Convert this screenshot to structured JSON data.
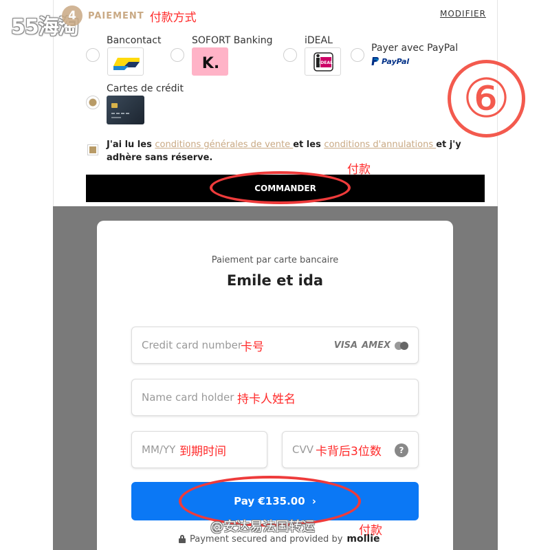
{
  "watermark_top": "55海淘",
  "watermark_bottom": "@安达易法国转运",
  "section": {
    "step_number": "4",
    "title": "PAIEMENT",
    "annotation": "付款方式",
    "modify_label": "MODIFIER"
  },
  "payment_options": [
    {
      "label": "Bancontact",
      "icon": "bancontact-logo",
      "selected": false
    },
    {
      "label": "SOFORT Banking",
      "icon": "klarna-sofort-logo",
      "selected": false
    },
    {
      "label": "iDEAL",
      "icon": "ideal-logo",
      "selected": false
    },
    {
      "label": "Payer avec PayPal",
      "icon": "paypal-logo",
      "logo_text": "PayPal",
      "selected": false
    },
    {
      "label": "Cartes de crédit",
      "icon": "credit-card-logo",
      "selected": true
    }
  ],
  "annotation_number": "⑥",
  "terms": {
    "part1": "J'ai lu les ",
    "link1": "conditions générales de vente ",
    "part2": "et les ",
    "link2": "conditions d'annulations ",
    "part3": "et j'y adhère sans réserve.",
    "checked": true
  },
  "commander": {
    "label": "COMMANDER",
    "annotation": "付款"
  },
  "modal": {
    "subtitle": "Paiement par carte bancaire",
    "title": "Emile et ida",
    "card_number": {
      "placeholder": "Credit card number",
      "annotation": "卡号",
      "brands": [
        "VISA",
        "AMEX",
        "mastercard"
      ]
    },
    "card_holder": {
      "placeholder": "Name card holder",
      "annotation": "持卡人姓名"
    },
    "expiry": {
      "placeholder": "MM/YY",
      "annotation": "到期时间"
    },
    "cvv": {
      "placeholder": "CVV",
      "annotation": "卡背后3位数",
      "help": "?"
    },
    "pay_button": {
      "label": "Pay €135.00",
      "chevron": "›"
    },
    "pay_annotation": "付款",
    "secured_text": "Payment secured and provided by",
    "provider": "mollie"
  },
  "colors": {
    "accent_gold": "#c9a984",
    "annotation_red": "#ff2a2a",
    "pay_blue": "#0b78f5",
    "overlay_grey": "#7a7a7a"
  }
}
